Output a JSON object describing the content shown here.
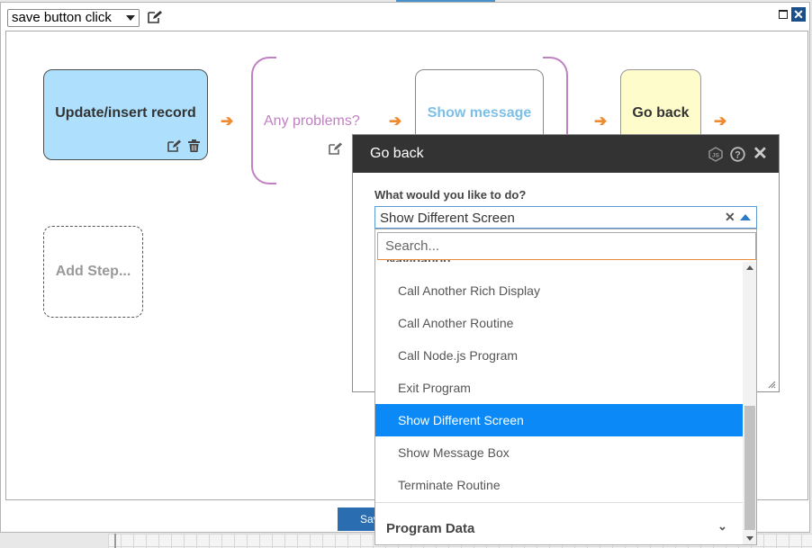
{
  "event": {
    "selected": "save button click",
    "edit_icon": "edit-icon"
  },
  "window": {
    "minimize_icon": "minimize-icon",
    "close_icon": "close-icon",
    "close_glyph": "✕"
  },
  "steps": {
    "update": {
      "label": "Update/insert record"
    },
    "condition": {
      "label": "Any problems?"
    },
    "message": {
      "label": "Show message"
    },
    "goback": {
      "label": "Go back"
    },
    "add": {
      "label": "Add Step..."
    }
  },
  "arrow_glyph": "➔",
  "footer": {
    "save_label": "Save"
  },
  "dialog": {
    "title": "Go back",
    "close_glyph": "✕",
    "question": "What would you like to do?",
    "combo": {
      "value": "Show Different Screen",
      "clear_glyph": "✕"
    },
    "dropdown": {
      "search_placeholder": "Search...",
      "group_name": "Navigation",
      "options": [
        "Call Another Rich Display",
        "Call Another Routine",
        "Call Node.js Program",
        "Exit Program",
        "Show Different Screen",
        "Show Message Box",
        "Terminate Routine"
      ],
      "selected_index": 4,
      "footer_group": "Program Data",
      "footer_chevron": "⌄"
    }
  },
  "colors": {
    "update_step": "#aee0fd",
    "goback_step": "#fffccb",
    "message_text": "#7dbfe6",
    "condition": "#c080c2",
    "arrow": "#f08a30",
    "dialog_title_bg": "#333333",
    "selected_option": "#0b8af7"
  }
}
